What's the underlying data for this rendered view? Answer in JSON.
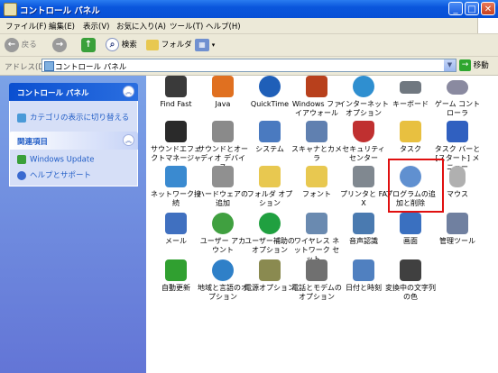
{
  "window": {
    "title": "コントロール パネル",
    "controls": {
      "minimize": "_",
      "maximize": "□",
      "close": "✕"
    }
  },
  "menu": [
    "ファイル(F)",
    "編集(E)",
    "表示(V)",
    "お気に入り(A)",
    "ツール(T)",
    "ヘルプ(H)"
  ],
  "toolbar": {
    "back": "戻る",
    "search": "検索",
    "folders": "フォルダ"
  },
  "address": {
    "label": "アドレス(D)",
    "value": "コントロール パネル",
    "go": "移動"
  },
  "sidebar": {
    "panel1": {
      "title": "コントロール パネル",
      "links": [
        "カテゴリの表示に切り替える"
      ]
    },
    "panel2": {
      "title": "関連項目",
      "links": [
        "Windows Update",
        "ヘルプとサポート"
      ]
    }
  },
  "icons": [
    {
      "label": "Find Fast",
      "icon": "binoculars-icon",
      "color": "#3a3a3a"
    },
    {
      "label": "Java",
      "icon": "java-cup-icon",
      "color": "#e07020"
    },
    {
      "label": "QuickTime",
      "icon": "quicktime-icon",
      "color": "#1f5fb8"
    },
    {
      "label": "Windows ファイアウォール",
      "icon": "firewall-icon",
      "color": "#b8401c"
    },
    {
      "label": "インターネット オプション",
      "icon": "globe-icon",
      "color": "#2f8fd0"
    },
    {
      "label": "キーボード",
      "icon": "keyboard-icon",
      "color": "#707880"
    },
    {
      "label": "ゲーム コントローラ",
      "icon": "gamepad-icon",
      "color": "#8a8aa0"
    },
    {
      "label": "サウンドエフェクトマネージャ",
      "icon": "sound-effect-icon",
      "color": "#2a2a2a"
    },
    {
      "label": "サウンドとオーディオ デバイス",
      "icon": "speaker-icon",
      "color": "#8a8a8a"
    },
    {
      "label": "システム",
      "icon": "computer-icon",
      "color": "#4a7ac0"
    },
    {
      "label": "スキャナとカメラ",
      "icon": "scanner-icon",
      "color": "#6080b0"
    },
    {
      "label": "セキュリティ センター",
      "icon": "shield-icon",
      "color": "#c03030"
    },
    {
      "label": "タスク",
      "icon": "task-folder-icon",
      "color": "#e8c040"
    },
    {
      "label": "タスク バーと [スタート] メニュー",
      "icon": "taskbar-icon",
      "color": "#3060c0"
    },
    {
      "label": "ネットワーク接続",
      "icon": "network-icon",
      "color": "#3a8ad0"
    },
    {
      "label": "ハードウェアの追加",
      "icon": "hardware-icon",
      "color": "#909090"
    },
    {
      "label": "フォルダ オプション",
      "icon": "folder-icon",
      "color": "#e8c850"
    },
    {
      "label": "フォント",
      "icon": "fonts-folder-icon",
      "color": "#e8c850"
    },
    {
      "label": "プリンタと FAX",
      "icon": "printer-icon",
      "color": "#808890"
    },
    {
      "label": "プログラムの追加と削除",
      "icon": "add-remove-programs-icon",
      "color": "#6090d0"
    },
    {
      "label": "マウス",
      "icon": "mouse-icon",
      "color": "#b0b0b0"
    },
    {
      "label": "メール",
      "icon": "mail-icon",
      "color": "#4070c0"
    },
    {
      "label": "ユーザー アカウント",
      "icon": "users-icon",
      "color": "#40a040"
    },
    {
      "label": "ユーザー補助のオプション",
      "icon": "accessibility-icon",
      "color": "#20a040"
    },
    {
      "label": "ワイヤレス ネットワーク セット...",
      "icon": "wireless-icon",
      "color": "#6a8ab0"
    },
    {
      "label": "音声認識",
      "icon": "speech-icon",
      "color": "#4a7ab0"
    },
    {
      "label": "画面",
      "icon": "display-icon",
      "color": "#3a70c0"
    },
    {
      "label": "管理ツール",
      "icon": "admin-tools-icon",
      "color": "#7080a0"
    },
    {
      "label": "自動更新",
      "icon": "windows-update-icon",
      "color": "#30a030"
    },
    {
      "label": "地域と言語のオプション",
      "icon": "globe-region-icon",
      "color": "#2f80c8"
    },
    {
      "label": "電源オプション",
      "icon": "power-icon",
      "color": "#8a8a50"
    },
    {
      "label": "電話とモデムのオプション",
      "icon": "phone-icon",
      "color": "#707070"
    },
    {
      "label": "日付と時刻",
      "icon": "clock-icon",
      "color": "#5080c0"
    },
    {
      "label": "変換中の文字列の色",
      "icon": "ime-color-icon",
      "color": "#404040"
    }
  ]
}
